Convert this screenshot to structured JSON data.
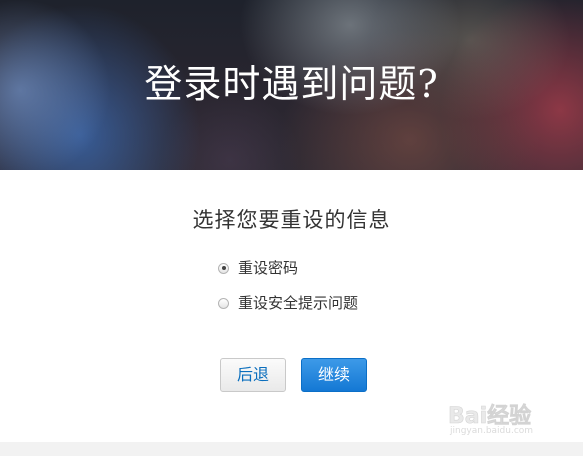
{
  "hero": {
    "title": "登录时遇到问题?"
  },
  "form": {
    "subtitle": "选择您要重设的信息",
    "options": [
      {
        "label": "重设密码",
        "checked": true
      },
      {
        "label": "重设安全提示问题",
        "checked": false
      }
    ]
  },
  "buttons": {
    "back_label": "后退",
    "continue_label": "继续"
  },
  "watermark": {
    "brand": "Bai经验",
    "url": "jingyan.baidu.com"
  },
  "colors": {
    "accent_blue": "#1478d4",
    "link_blue": "#0a6ebd"
  }
}
